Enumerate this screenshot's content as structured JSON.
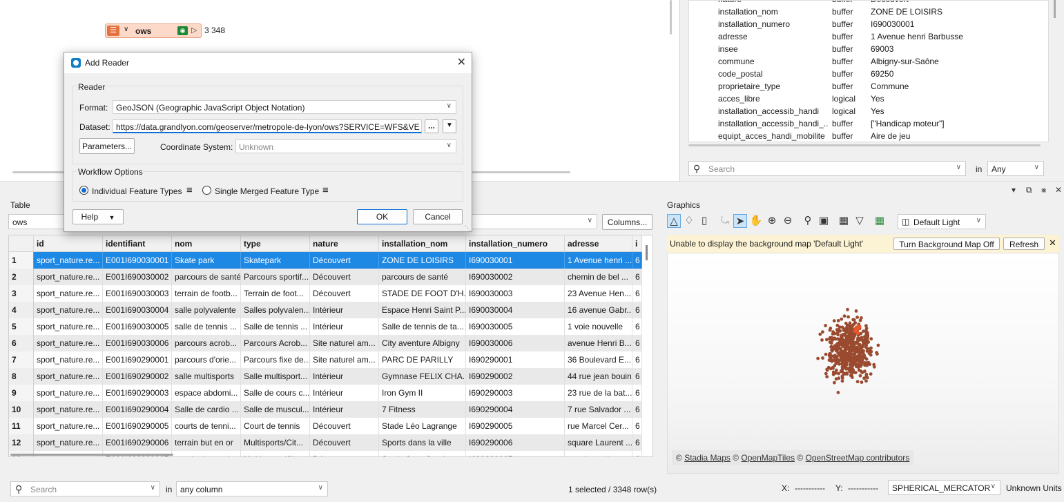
{
  "canvas": {
    "reader_node": {
      "name": "ows",
      "count": "3 348"
    }
  },
  "attributes": {
    "rows": [
      {
        "name": "nature",
        "type": "buffer",
        "value": "Découvert"
      },
      {
        "name": "installation_nom",
        "type": "buffer",
        "value": "ZONE DE LOISIRS"
      },
      {
        "name": "installation_numero",
        "type": "buffer",
        "value": "I690030001"
      },
      {
        "name": "adresse",
        "type": "buffer",
        "value": "1 Avenue henri Barbusse"
      },
      {
        "name": "insee",
        "type": "buffer",
        "value": "69003"
      },
      {
        "name": "commune",
        "type": "buffer",
        "value": "Albigny-sur-Saône"
      },
      {
        "name": "code_postal",
        "type": "buffer",
        "value": "69250"
      },
      {
        "name": "proprietaire_type",
        "type": "buffer",
        "value": "Commune"
      },
      {
        "name": "acces_libre",
        "type": "logical",
        "value": "Yes"
      },
      {
        "name": "installation_accessib_handi",
        "type": "logical",
        "value": "Yes"
      },
      {
        "name": "installation_accessib_handi_...",
        "type": "buffer",
        "value": "[\"Handicap moteur\"]"
      },
      {
        "name": "equipt_acces_handi_mobilite",
        "type": "buffer",
        "value": "Aire de jeu"
      }
    ],
    "search_placeholder": "Search",
    "in_label": "in",
    "scope": "Any"
  },
  "table": {
    "title": "Table",
    "filter_value": "ows",
    "columns_button": "Columns...",
    "headers": [
      "id",
      "identifiant",
      "nom",
      "type",
      "nature",
      "installation_nom",
      "installation_numero",
      "adresse",
      "i"
    ],
    "rows": [
      [
        "1",
        "sport_nature.re...",
        "E001I690030001",
        "Skate park",
        "Skatepark",
        "Découvert",
        "ZONE DE LOISIRS",
        "I690030001",
        "1 Avenue henri ...",
        "6"
      ],
      [
        "2",
        "sport_nature.re...",
        "E001I690030002",
        "parcours de santé",
        "Parcours sportif...",
        "Découvert",
        "parcours de santé",
        "I690030002",
        "chemin de bel ...",
        "6"
      ],
      [
        "3",
        "sport_nature.re...",
        "E001I690030003",
        "terrain de footb...",
        "Terrain de foot...",
        "Découvert",
        "STADE DE FOOT D'H...",
        "I690030003",
        "23 Avenue Hen...",
        "6"
      ],
      [
        "4",
        "sport_nature.re...",
        "E001I690030004",
        "salle polyvalente",
        "Salles polyvalen...",
        "Intérieur",
        "Espace Henri Saint P...",
        "I690030004",
        "16 avenue Gabr...",
        "6"
      ],
      [
        "5",
        "sport_nature.re...",
        "E001I690030005",
        "salle de tennis ...",
        "Salle de tennis ...",
        "Intérieur",
        "Salle de tennis de ta...",
        "I690030005",
        "1 voie nouvelle",
        "6"
      ],
      [
        "6",
        "sport_nature.re...",
        "E001I690030006",
        "parcours acrob...",
        "Parcours Acrob...",
        "Site naturel am...",
        "City aventure Albigny",
        "I690030006",
        "avenue Henri B...",
        "6"
      ],
      [
        "7",
        "sport_nature.re...",
        "E001I690290001",
        "parcours d'orie...",
        "Parcours fixe de...",
        "Site naturel am...",
        "PARC DE PARILLY",
        "I690290001",
        "36 Boulevard E...",
        "6"
      ],
      [
        "8",
        "sport_nature.re...",
        "E001I690290002",
        "salle multisports",
        "Salle multisport...",
        "Intérieur",
        "Gymnase FELIX CHA...",
        "I690290002",
        "44 rue jean bouin",
        "6"
      ],
      [
        "9",
        "sport_nature.re...",
        "E001I690290003",
        "espace abdomi...",
        "Salle de cours c...",
        "Intérieur",
        "Iron Gym II",
        "I690290003",
        "23 rue de la bat...",
        "6"
      ],
      [
        "10",
        "sport_nature.re...",
        "E001I690290004",
        "Salle de cardio ...",
        "Salle de muscul...",
        "Intérieur",
        "7 Fitness",
        "I690290004",
        "7 rue Salvador ...",
        "6"
      ],
      [
        "11",
        "sport_nature.re...",
        "E001I690290005",
        "courts de tenni...",
        "Court de tennis",
        "Découvert",
        "Stade Léo Lagrange",
        "I690290005",
        "rue Marcel Cer...",
        "6"
      ],
      [
        "12",
        "sport_nature.re...",
        "E001I690290006",
        "terrain but en or",
        "Multisports/Cit...",
        "Découvert",
        "Sports dans la ville",
        "I690290006",
        "square Laurent ...",
        "6"
      ],
      [
        "13",
        "sport_nature.re...",
        "E001I690290007",
        "terrain de proxi...",
        "Multisports/Cit...",
        "Découvert",
        "Stade Jean Jaurès",
        "I690290007",
        "rue du stade",
        "6"
      ]
    ],
    "search_placeholder": "Search",
    "in_label": "in",
    "scope": "any column",
    "status": "1 selected / 3348 row(s)"
  },
  "graphics": {
    "title": "Graphics",
    "basemap": "Default Light",
    "warning": "Unable to display the background map 'Default Light'",
    "turn_off_button": "Turn Background Map Off",
    "refresh_button": "Refresh",
    "attribution": {
      "c1": "©",
      "a1": "Stadia Maps",
      "c2": "©",
      "a2": "OpenMapTiles",
      "c3": "©",
      "a3": "OpenStreetMap contributors"
    },
    "x_label": "X:",
    "x_value": "-----------",
    "y_label": "Y:",
    "y_value": "-----------",
    "crs": "SPHERICAL_MERCATOR",
    "units": "Unknown Units",
    "point_color": "#9a4a2e",
    "highlight_color": "#e8562a"
  },
  "dialog": {
    "title": "Add Reader",
    "reader_group": "Reader",
    "format_label": "Format:",
    "format_value": "GeoJSON (Geographic JavaScript Object Notation)",
    "dataset_label": "Dataset:",
    "dataset_value": "https://data.grandlyon.com/geoserver/metropole-de-lyon/ows?SERVICE=WFS&VER",
    "browse_button": "...",
    "parameters_button": "Parameters...",
    "coord_label": "Coordinate System:",
    "coord_value": "Unknown",
    "workflow_group": "Workflow Options",
    "opt_individual": "Individual Feature Types",
    "opt_merged": "Single Merged Feature Type",
    "help_button": "Help",
    "ok_button": "OK",
    "cancel_button": "Cancel"
  }
}
